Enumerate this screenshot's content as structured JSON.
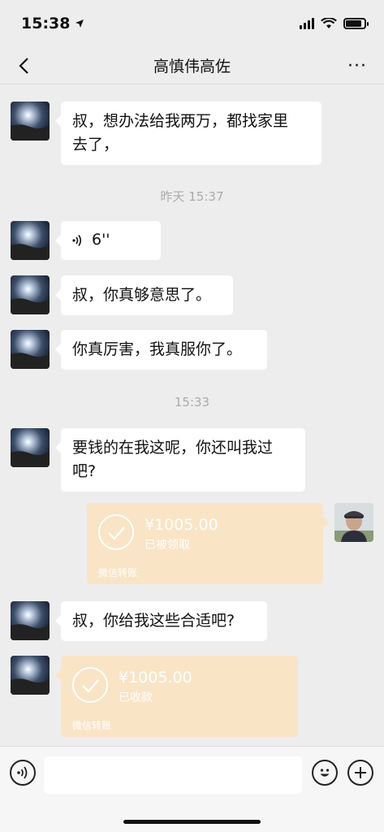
{
  "status_bar": {
    "time": "15:38",
    "battery_level": 0.85
  },
  "nav": {
    "title": "高慎伟高佐",
    "more_label": "···"
  },
  "messages": {
    "m1": "叔，想办法给我两万，都找家里",
    "m1b": "去了，",
    "sep1": "昨天 15:37",
    "voice_duration": "6''",
    "m2": "叔，你真够意思了。",
    "m3": "你真厉害，我真服你了。",
    "sep2": "15:33",
    "m4": "要钱的在我这呢，你还叫我过",
    "m4b": "吧?",
    "transfer1": {
      "amount": "¥1005.00",
      "status": "已被领取",
      "label": "微信转账"
    },
    "m5": "叔，你给我这些合适吧?",
    "transfer2": {
      "amount": "¥1005.00",
      "status": "已收款",
      "label": "微信转账"
    }
  },
  "icons": {
    "back": "chevron-left-icon",
    "more": "more-icon",
    "voice": "voice-icon",
    "emoji": "emoji-icon",
    "plus": "plus-icon"
  },
  "colors": {
    "background": "#ededed",
    "transfer": "#f9e4c6",
    "bubble": "#ffffff"
  }
}
